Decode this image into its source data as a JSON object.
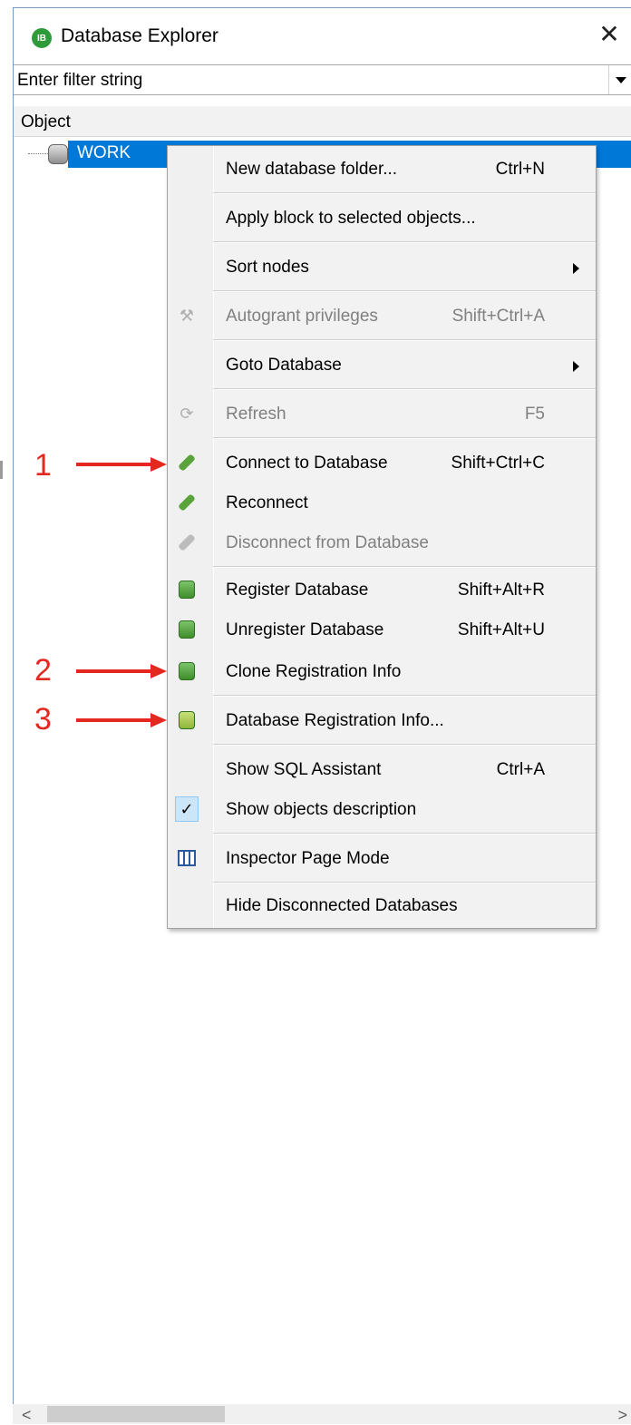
{
  "window": {
    "title": "Database Explorer",
    "app_icon_text": "IB",
    "close_symbol": "✕"
  },
  "filter": {
    "placeholder": "Enter filter string"
  },
  "tree": {
    "header": "Object",
    "items": [
      {
        "label": "WORK",
        "icon": "database-icon",
        "selected": true
      }
    ]
  },
  "context_menu": {
    "items": [
      {
        "label": "New database folder...",
        "shortcut": "Ctrl+N"
      },
      {
        "label": "Apply block to selected objects...",
        "shortcut": ""
      },
      {
        "label": "Sort nodes",
        "shortcut": "",
        "submenu": true
      },
      {
        "label": "Autogrant privileges",
        "shortcut": "Shift+Ctrl+A",
        "disabled": true,
        "icon": "autogrant-icon"
      },
      {
        "label": "Goto Database",
        "shortcut": "",
        "submenu": true
      },
      {
        "label": "Refresh",
        "shortcut": "F5",
        "disabled": true,
        "icon": "refresh-icon"
      },
      {
        "label": "Connect to Database",
        "shortcut": "Shift+Ctrl+C",
        "icon": "connect-icon"
      },
      {
        "label": "Reconnect",
        "shortcut": "",
        "icon": "reconnect-icon"
      },
      {
        "label": "Disconnect from Database",
        "shortcut": "",
        "disabled": true,
        "icon": "disconnect-icon"
      },
      {
        "label": "Register Database",
        "shortcut": "Shift+Alt+R",
        "icon": "register-database-icon"
      },
      {
        "label": "Unregister Database",
        "shortcut": "Shift+Alt+U",
        "icon": "unregister-database-icon"
      },
      {
        "label": "Clone Registration Info",
        "shortcut": "",
        "icon": "clone-registration-icon"
      },
      {
        "label": "Database Registration Info...",
        "shortcut": "",
        "icon": "registration-info-icon"
      },
      {
        "label": "Show SQL Assistant",
        "shortcut": "Ctrl+A"
      },
      {
        "label": "Show objects description",
        "shortcut": "",
        "checked": true,
        "icon": "checkmark-icon"
      },
      {
        "label": "Inspector Page Mode",
        "shortcut": "",
        "icon": "inspector-icon"
      },
      {
        "label": "Hide Disconnected Databases",
        "shortcut": ""
      }
    ]
  },
  "annotations": [
    "1",
    "2",
    "3"
  ],
  "colors": {
    "selection": "#0078d7",
    "annotation": "#e3281f",
    "disabled_text": "#808080"
  }
}
